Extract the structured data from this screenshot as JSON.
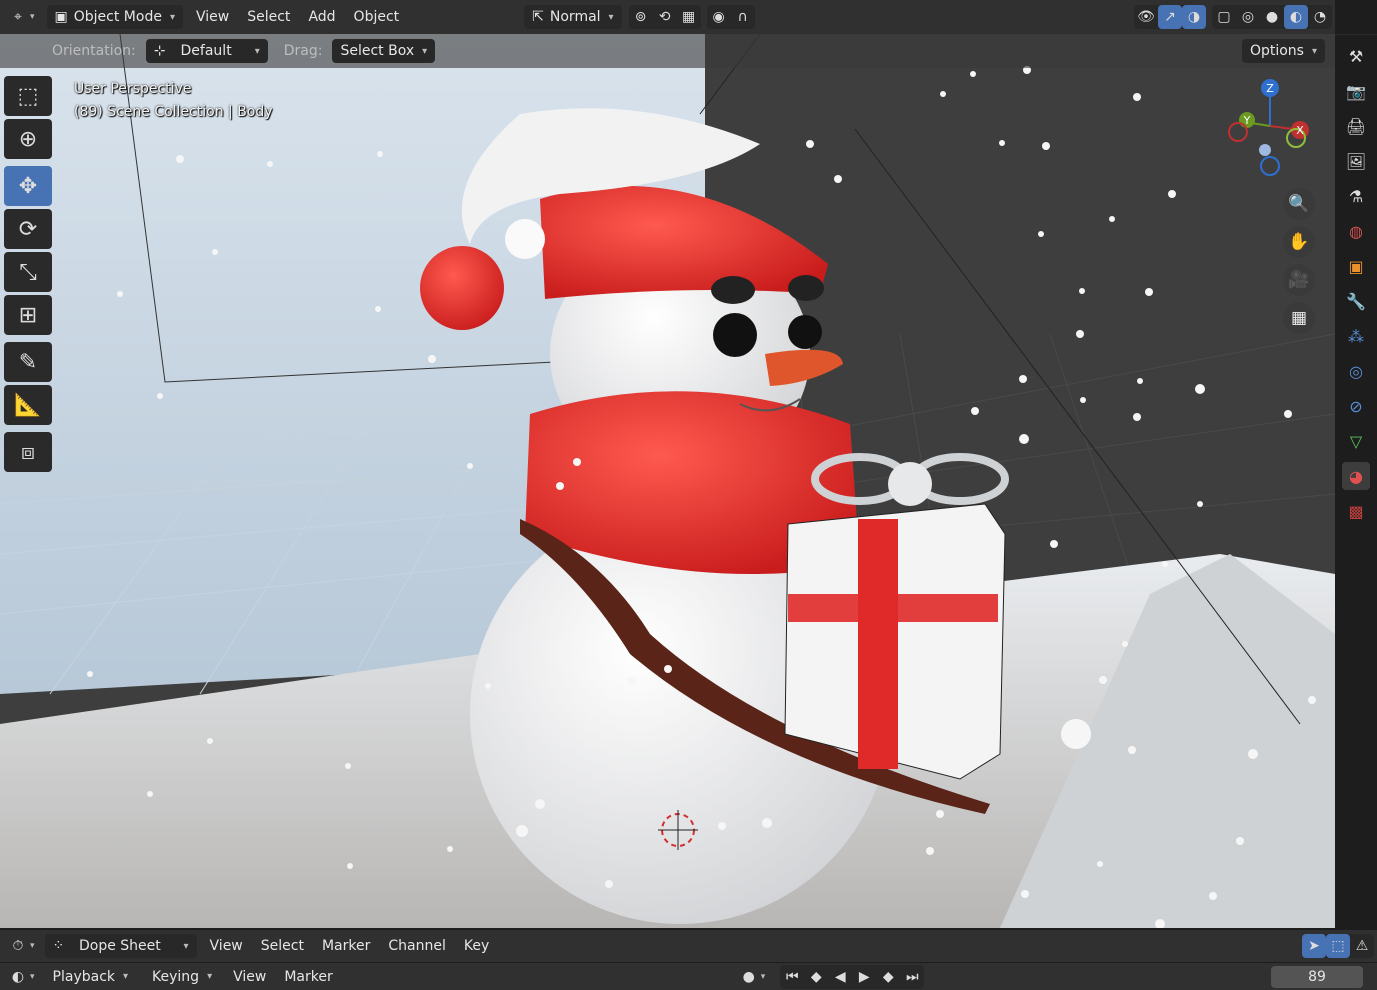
{
  "header": {
    "mode": "Object Mode",
    "menus": [
      "View",
      "Select",
      "Add",
      "Object"
    ],
    "transform_orientation": "Normal",
    "options": "Options"
  },
  "toolbar": {
    "orientation_label": "Orientation:",
    "orientation_value": "Default",
    "drag_label": "Drag:",
    "drag_value": "Select Box"
  },
  "viewport": {
    "perspective": "User Perspective",
    "collection": "(89) Scene Collection | Body",
    "gizmo_axes": [
      "Z",
      "Y",
      "X"
    ]
  },
  "dope_sheet": {
    "editor": "Dope Sheet",
    "menus": [
      "View",
      "Select",
      "Marker",
      "Channel",
      "Key"
    ]
  },
  "timeline": {
    "menus": [
      "Playback",
      "Keying",
      "View",
      "Marker"
    ],
    "current_frame": "89"
  },
  "colors": {
    "accent": "#4772b3",
    "header": "#303030",
    "dark": "#1d1d1d"
  }
}
